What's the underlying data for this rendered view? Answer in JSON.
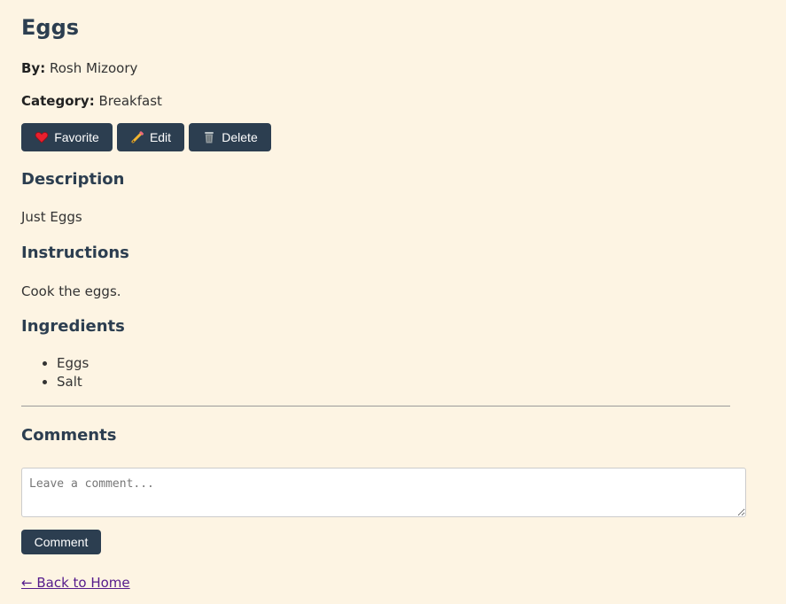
{
  "recipe": {
    "title": "Eggs",
    "by_label": "By:",
    "author": "Rosh Mizoory",
    "category_label": "Category:",
    "category": "Breakfast"
  },
  "actions": {
    "favorite_label": "Favorite",
    "edit_label": "Edit",
    "delete_label": "Delete",
    "favorite_icon": "heart-icon",
    "edit_icon": "pencil-icon",
    "delete_icon": "trash-icon"
  },
  "sections": {
    "description_heading": "Description",
    "description_text": "Just Eggs",
    "instructions_heading": "Instructions",
    "instructions_text": "Cook the eggs.",
    "ingredients_heading": "Ingredients",
    "ingredients": [
      "Eggs",
      "Salt"
    ]
  },
  "comments": {
    "heading": "Comments",
    "placeholder": "Leave a comment...",
    "value": "",
    "submit_label": "Comment"
  },
  "nav": {
    "back_label": "← Back to Home"
  },
  "colors": {
    "background": "#fdf4e3",
    "accent": "#2c3e50",
    "link_visited": "#551a8b"
  }
}
